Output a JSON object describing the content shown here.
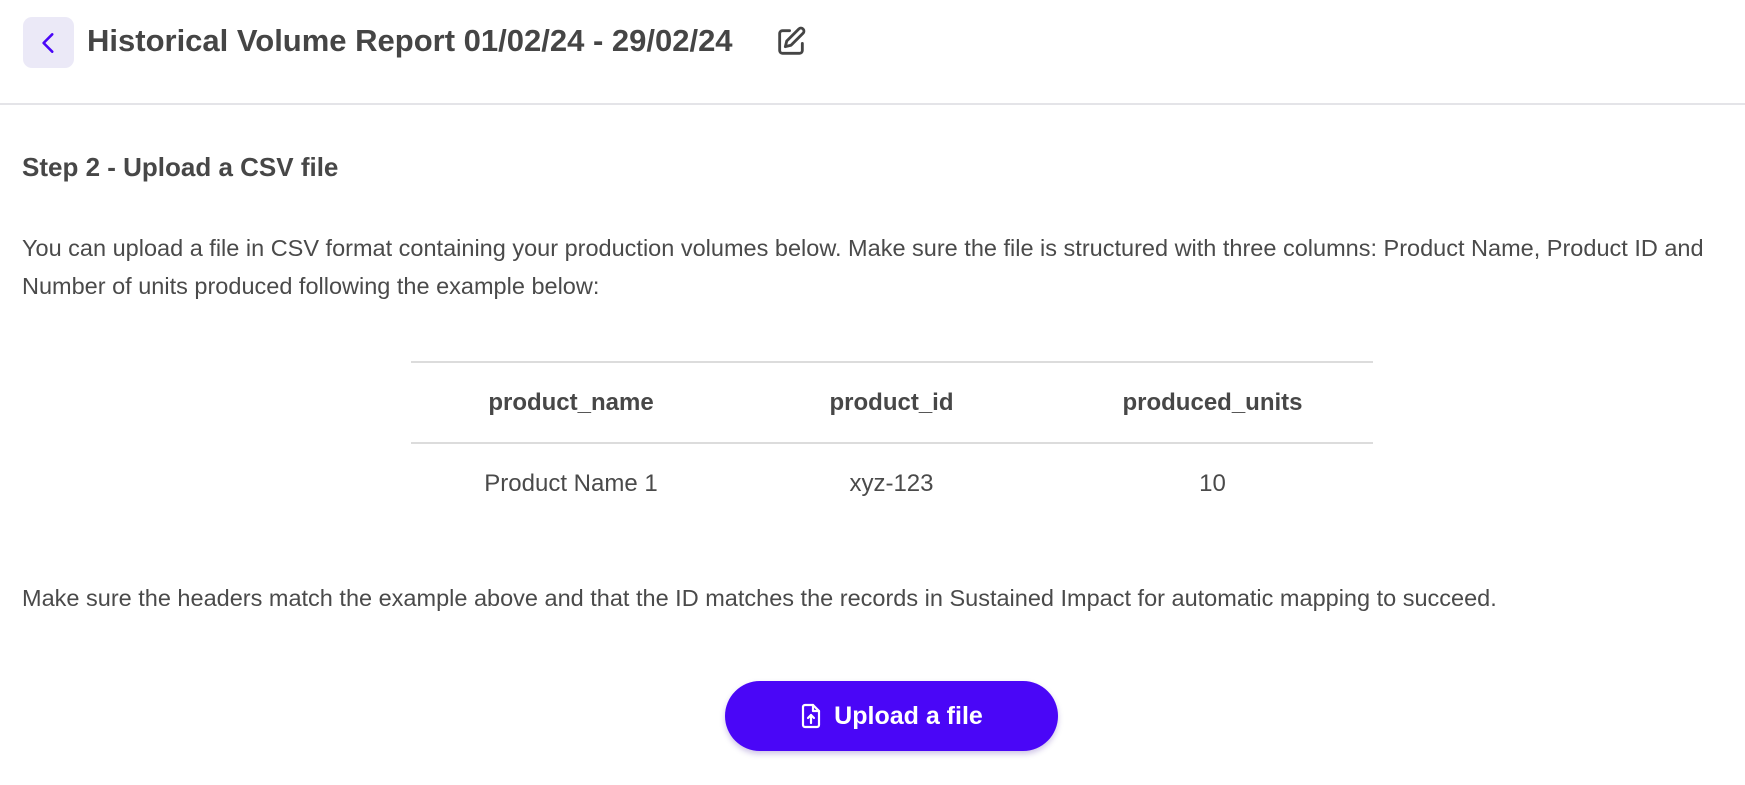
{
  "header": {
    "title": "Historical Volume Report 01/02/24 - 29/02/24",
    "back_icon": "chevron-left-icon",
    "edit_icon": "pencil-square-icon"
  },
  "step": {
    "title": "Step 2 - Upload a CSV file",
    "intro": "You can upload a file in CSV format containing your production volumes below. Make sure the file is structured with three columns: Product Name, Product ID and Number of units produced following the example below:"
  },
  "example_table": {
    "headers": [
      "product_name",
      "product_id",
      "produced_units"
    ],
    "rows": [
      [
        "Product Name 1",
        "xyz-123",
        "10"
      ]
    ]
  },
  "note": "Make sure the headers match the example above and that the ID matches the records in Sustained Impact for automatic mapping to succeed.",
  "upload": {
    "label": "Upload a file",
    "icon": "file-upload-icon"
  },
  "colors": {
    "accent": "#4a06f7",
    "back_button_bg": "#ebe9f7",
    "text": "#4a4a4a",
    "divider": "#dcdcdc"
  }
}
